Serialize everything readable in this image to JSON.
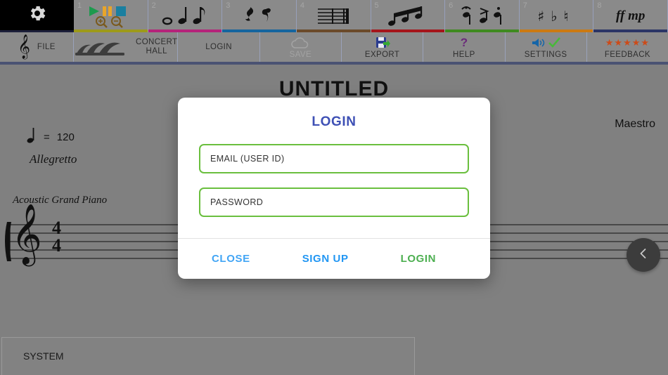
{
  "app": {
    "background_color": "#808080",
    "accent_blue": "#3f51b5",
    "accent_green": "#6abf3e"
  },
  "toolbar": {
    "gear_icon": "gear-icon",
    "tabs": [
      {
        "number": "1",
        "strip_color": "#9d9a1b",
        "icon": "playback-transport-icon"
      },
      {
        "number": "2",
        "strip_color": "#b5237a",
        "icon": "note-durations-icon"
      },
      {
        "number": "3",
        "strip_color": "#15659e",
        "icon": "rests-icon"
      },
      {
        "number": "4",
        "strip_color": "#6b4a2a",
        "icon": "barlines-icon"
      },
      {
        "number": "5",
        "strip_color": "#a5151b",
        "icon": "beamed-notes-icon"
      },
      {
        "number": "6",
        "strip_color": "#3f8a20",
        "icon": "articulations-icon"
      },
      {
        "number": "7",
        "strip_color": "#cc7a12",
        "icon": "accidentals-icon"
      },
      {
        "number": "8",
        "strip_color": "#2b3566",
        "icon": "dynamics-icon"
      }
    ],
    "tab8_glyph": "ff mp"
  },
  "menu": {
    "items": [
      {
        "label": "FILE",
        "icon": "treble-clef-icon",
        "disabled": false
      },
      {
        "label": "CONCERT HALL",
        "line1": "CONCERT",
        "line2": "HALL",
        "icon": "opera-house-icon",
        "disabled": false
      },
      {
        "label": "LOGIN",
        "icon": "none",
        "disabled": false
      },
      {
        "label": "SAVE",
        "icon": "cloud-icon",
        "disabled": true
      },
      {
        "label": "EXPORT",
        "icon": "floppy-disk-icon",
        "disabled": false
      },
      {
        "label": "HELP",
        "icon": "question-mark-icon",
        "disabled": false
      },
      {
        "label": "SETTINGS",
        "icon": "speaker-check-icon",
        "disabled": false
      },
      {
        "label": "FEEDBACK",
        "icon": "five-stars-icon",
        "disabled": false
      }
    ]
  },
  "score": {
    "title": "UNTITLED",
    "tempo_equals": "=",
    "tempo_bpm": "120",
    "tempo_word": "Allegretto",
    "composer": "Maestro",
    "instrument": "Acoustic Grand Piano",
    "time_signature_top": "4",
    "time_signature_bottom": "4",
    "system_label": "SYSTEM"
  },
  "fab": {
    "icon": "chevron-left-icon"
  },
  "dialog": {
    "title": "LOGIN",
    "email_placeholder": "EMAIL (USER ID)",
    "email_value": "",
    "password_placeholder": "PASSWORD",
    "password_value": "",
    "close_label": "CLOSE",
    "signup_label": "SIGN UP",
    "login_label": "LOGIN"
  }
}
